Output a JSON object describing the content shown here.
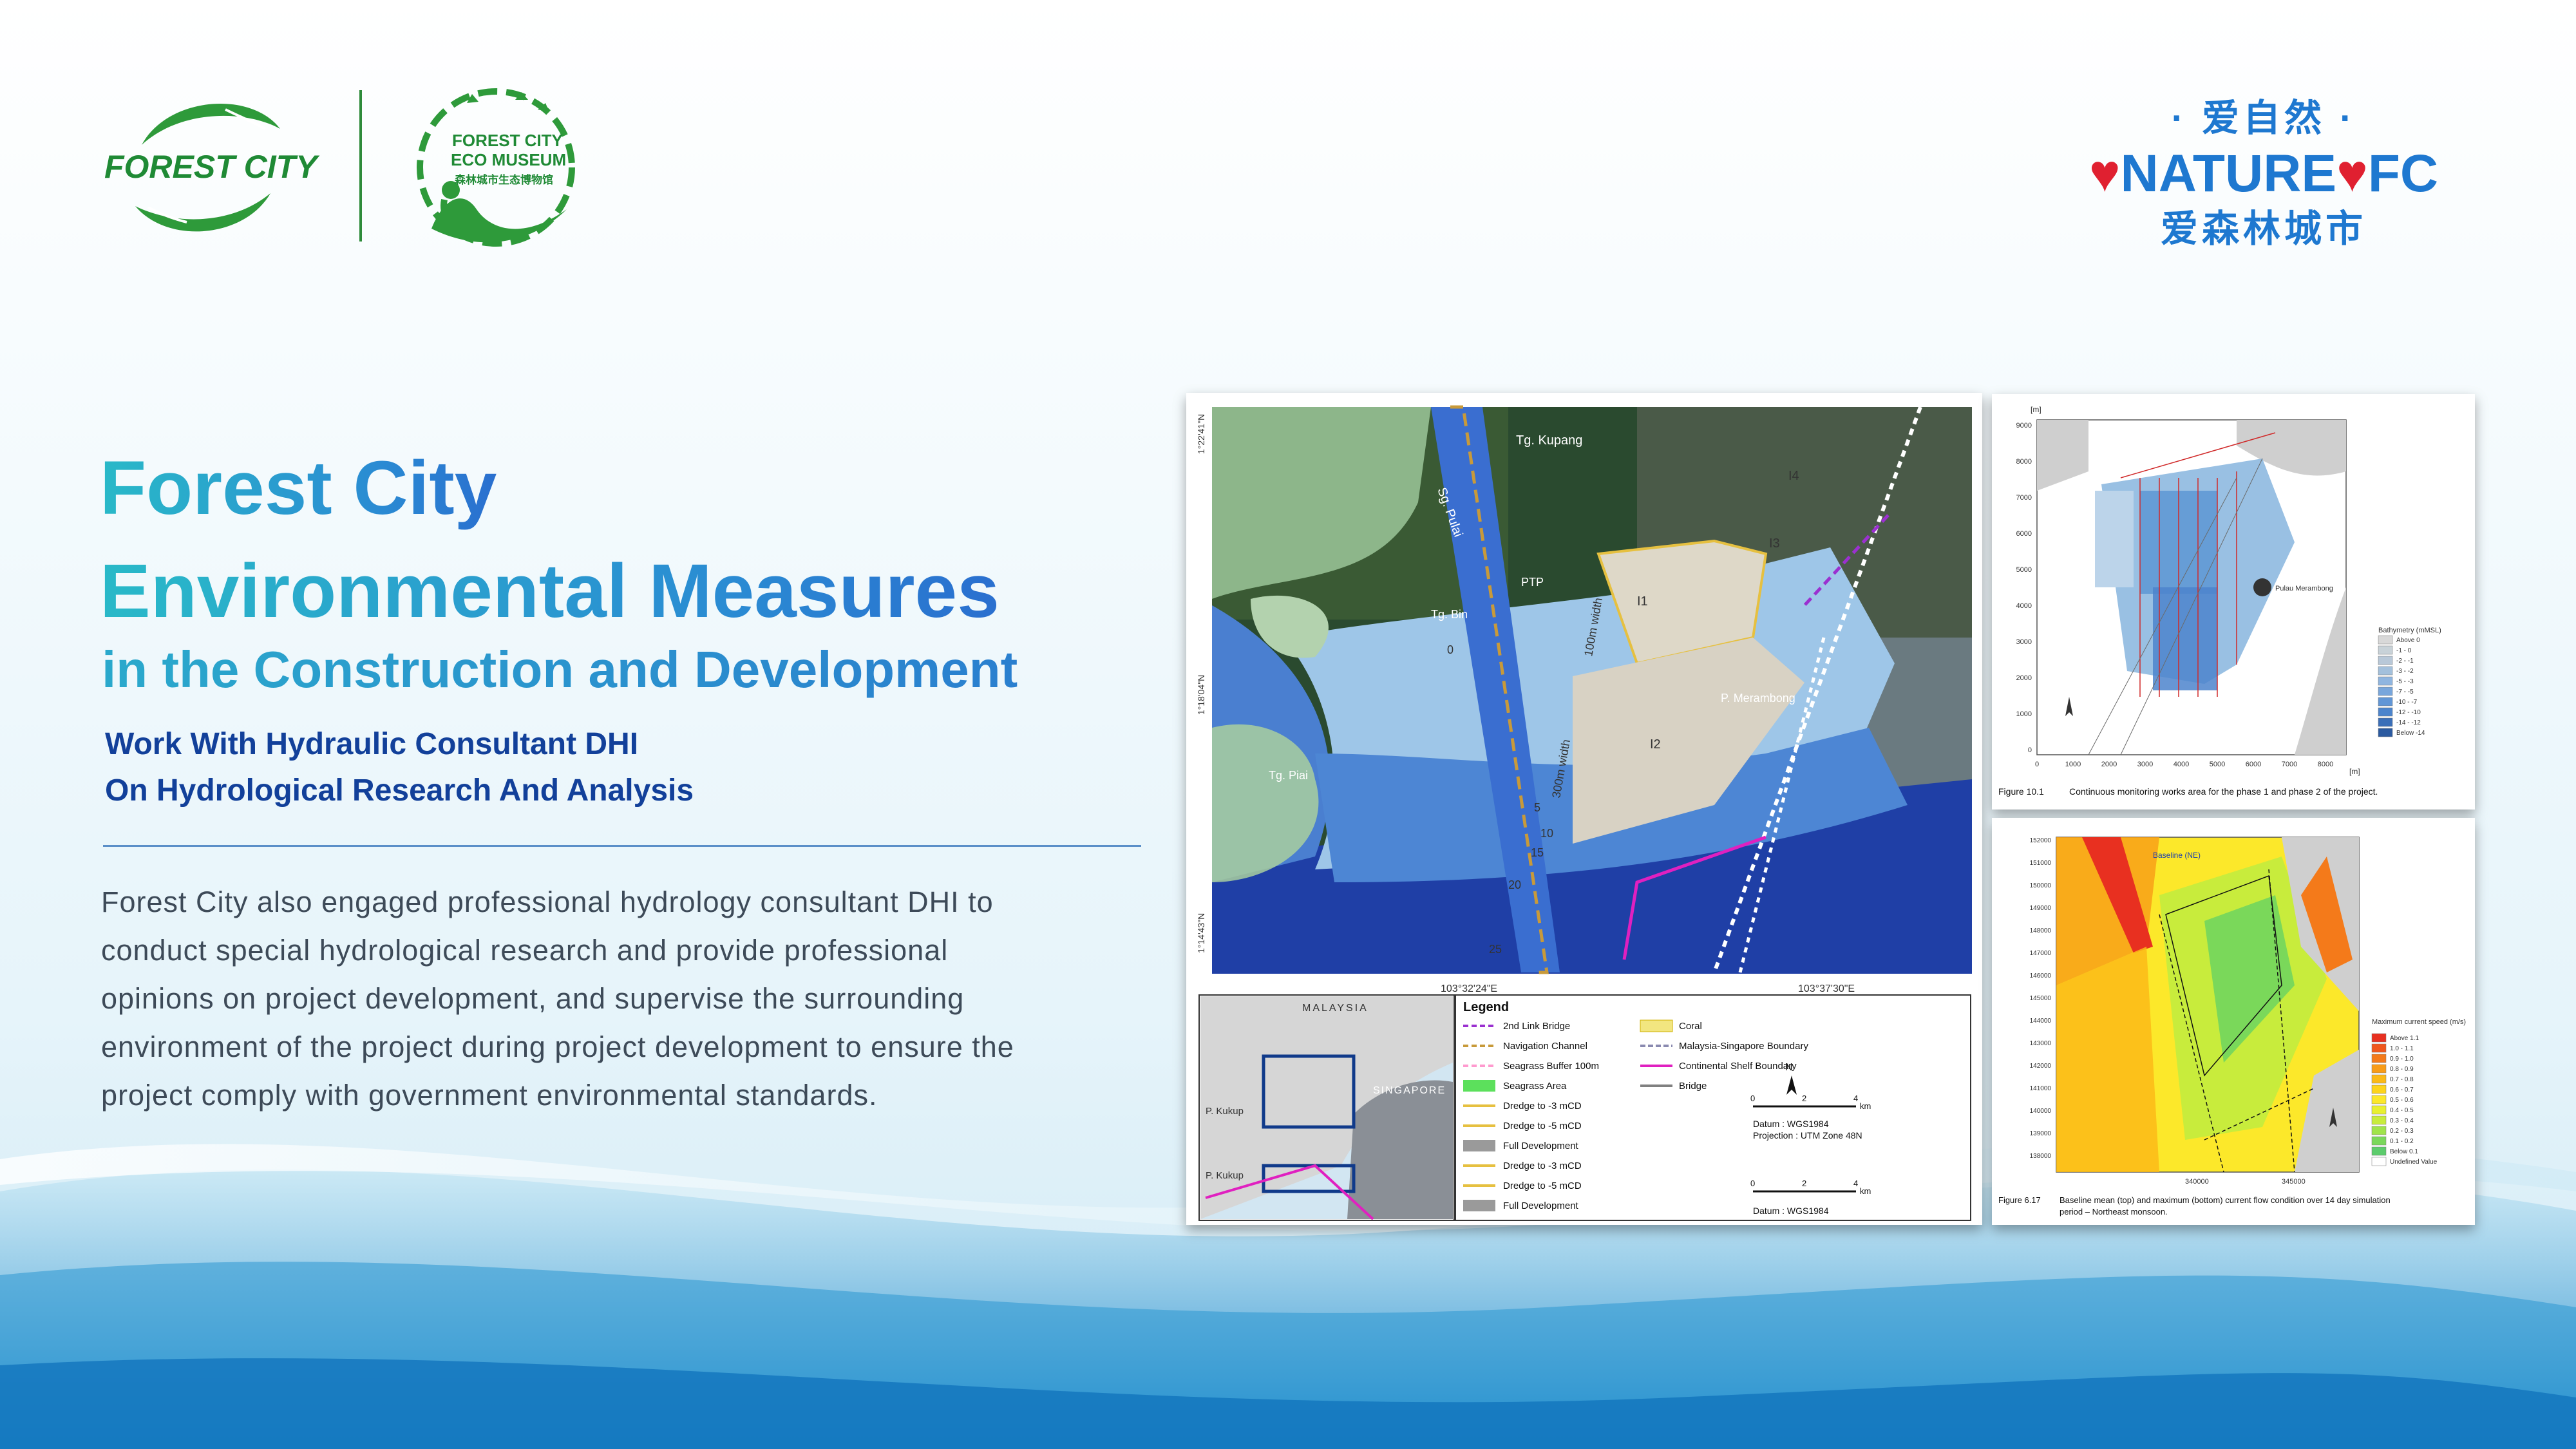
{
  "brand": {
    "forest_city_logo_text": "FOREST CITY",
    "eco_museum_line1": "FOREST CITY",
    "eco_museum_line2": "ECO MUSEUM",
    "eco_museum_cn": "森林城市生态博物馆",
    "nature_top": "· 爱自然 ·",
    "nature_word": "NATURE",
    "nature_fc": "FC",
    "nature_bottom": "爱森林城市"
  },
  "heading": {
    "line1": "Forest City",
    "line2": "Environmental Measures",
    "line3": "in the Construction and Development"
  },
  "subheading": {
    "line1": "Work With Hydraulic Consultant DHI",
    "line2": "On Hydrological Research And Analysis"
  },
  "body": {
    "line1": "Forest City also engaged professional hydrology consultant DHI to",
    "line2": "conduct special hydrological research and provide professional",
    "line3": "opinions on project development, and supervise the surrounding",
    "line4": "environment of the project during project development to ensure the",
    "line5": "project comply with government environmental standards."
  },
  "map": {
    "labels": {
      "kupang": "Tg. Kupang",
      "pulai": "Sg. Pulai",
      "ptp": "PTP",
      "bin": "Tg. Bin",
      "piai": "Tg. Piai",
      "merambong": "P. Merambong",
      "width100": "100m width",
      "width300": "300m width",
      "i1": "I1",
      "i2": "I2",
      "i3": "I3",
      "i4": "I4",
      "d0": "0",
      "d5": "5",
      "d10": "10",
      "d15": "15",
      "d20": "20",
      "d25": "25",
      "lon1": "103°32'24\"E",
      "lon2": "103°37'30\"E",
      "lat1": "1°22'41\"N",
      "lat2": "1°18'04\"N",
      "lat3": "1°14'43\"N"
    },
    "inset": {
      "malaysia": "MALAYSIA",
      "singapore": "SINGAPORE",
      "kukup1": "P. Kukup",
      "kukup2": "P. Kukup"
    },
    "legend": {
      "title": "Legend",
      "items_left": [
        "2nd Link Bridge",
        "Navigation Channel",
        "Seagrass Buffer 100m",
        "Seagrass Area",
        "Dredge to -3 mCD",
        "Dredge to -5 mCD",
        "Full Development",
        "Dredge to -3 mCD",
        "Dredge to -5 mCD",
        "Full Development"
      ],
      "items_right": [
        "Coral",
        "Malaysia-Singapore Boundary",
        "Continental Shelf Boundary",
        "Bridge"
      ],
      "datum1": "Datum    : WGS1984",
      "projection": "Projection : UTM Zone 48N",
      "datum2": "Datum    : WGS1984",
      "north": "N",
      "km": "km",
      "s0": "0",
      "s2": "2",
      "s4": "4"
    }
  },
  "figure_top": {
    "caption_num": "Figure 10.1",
    "caption": "Continuous monitoring works area for the phase 1 and phase 2 of the project.",
    "unit_y": "[m]",
    "unit_x": "[m]",
    "y_ticks": [
      "9000",
      "8000",
      "7000",
      "6000",
      "5000",
      "4000",
      "3000",
      "2000",
      "1000",
      "0"
    ],
    "x_ticks": [
      "0",
      "1000",
      "2000",
      "3000",
      "4000",
      "5000",
      "6000",
      "7000",
      "8000"
    ],
    "island": "Pulau Merambong",
    "legend_title": "Bathymetry (mMSL)",
    "legend_items": [
      "Above 0",
      "-1 - 0",
      "-2 - -1",
      "-3 - -2",
      "-5 - -3",
      "-7 - -5",
      "-10 - -7",
      "-12 - -10",
      "-14 - -12",
      "Below -14"
    ],
    "legend_colors": [
      "#d8d8d8",
      "#c8d2d8",
      "#b8c8d8",
      "#a3c0dc",
      "#8fb5e0",
      "#78a6dc",
      "#6196d6",
      "#4c84cc",
      "#3b6fb8",
      "#2b5aa0"
    ]
  },
  "figure_bot": {
    "caption_num": "Figure 6.17",
    "caption_l1": "Baseline mean (top) and maximum (bottom) current flow condition over 14 day simulation",
    "caption_l2": "period – Northeast monsoon.",
    "label": "Baseline (NE)",
    "y_ticks": [
      "152000",
      "151000",
      "150000",
      "149000",
      "148000",
      "147000",
      "146000",
      "145000",
      "144000",
      "143000",
      "142000",
      "141000",
      "140000",
      "139000",
      "138000"
    ],
    "x_ticks": [
      "340000",
      "345000"
    ],
    "legend_title": "Maximum current speed (m/s)",
    "legend_items": [
      "Above 1.1",
      "1.0 - 1.1",
      "0.9 - 1.0",
      "0.8 - 0.9",
      "0.7 - 0.8",
      "0.6 - 0.7",
      "0.5 - 0.6",
      "0.4 - 0.5",
      "0.3 - 0.4",
      "0.2 - 0.3",
      "0.1 - 0.2",
      "Below 0.1",
      "Undefined Value"
    ],
    "legend_colors": [
      "#e83020",
      "#f0561c",
      "#f47a1a",
      "#f89c18",
      "#fbba18",
      "#fdd41c",
      "#fce82a",
      "#e8f030",
      "#c8ec3c",
      "#a0e44a",
      "#7ad85a",
      "#5ccc6c",
      "#ffffff"
    ]
  }
}
